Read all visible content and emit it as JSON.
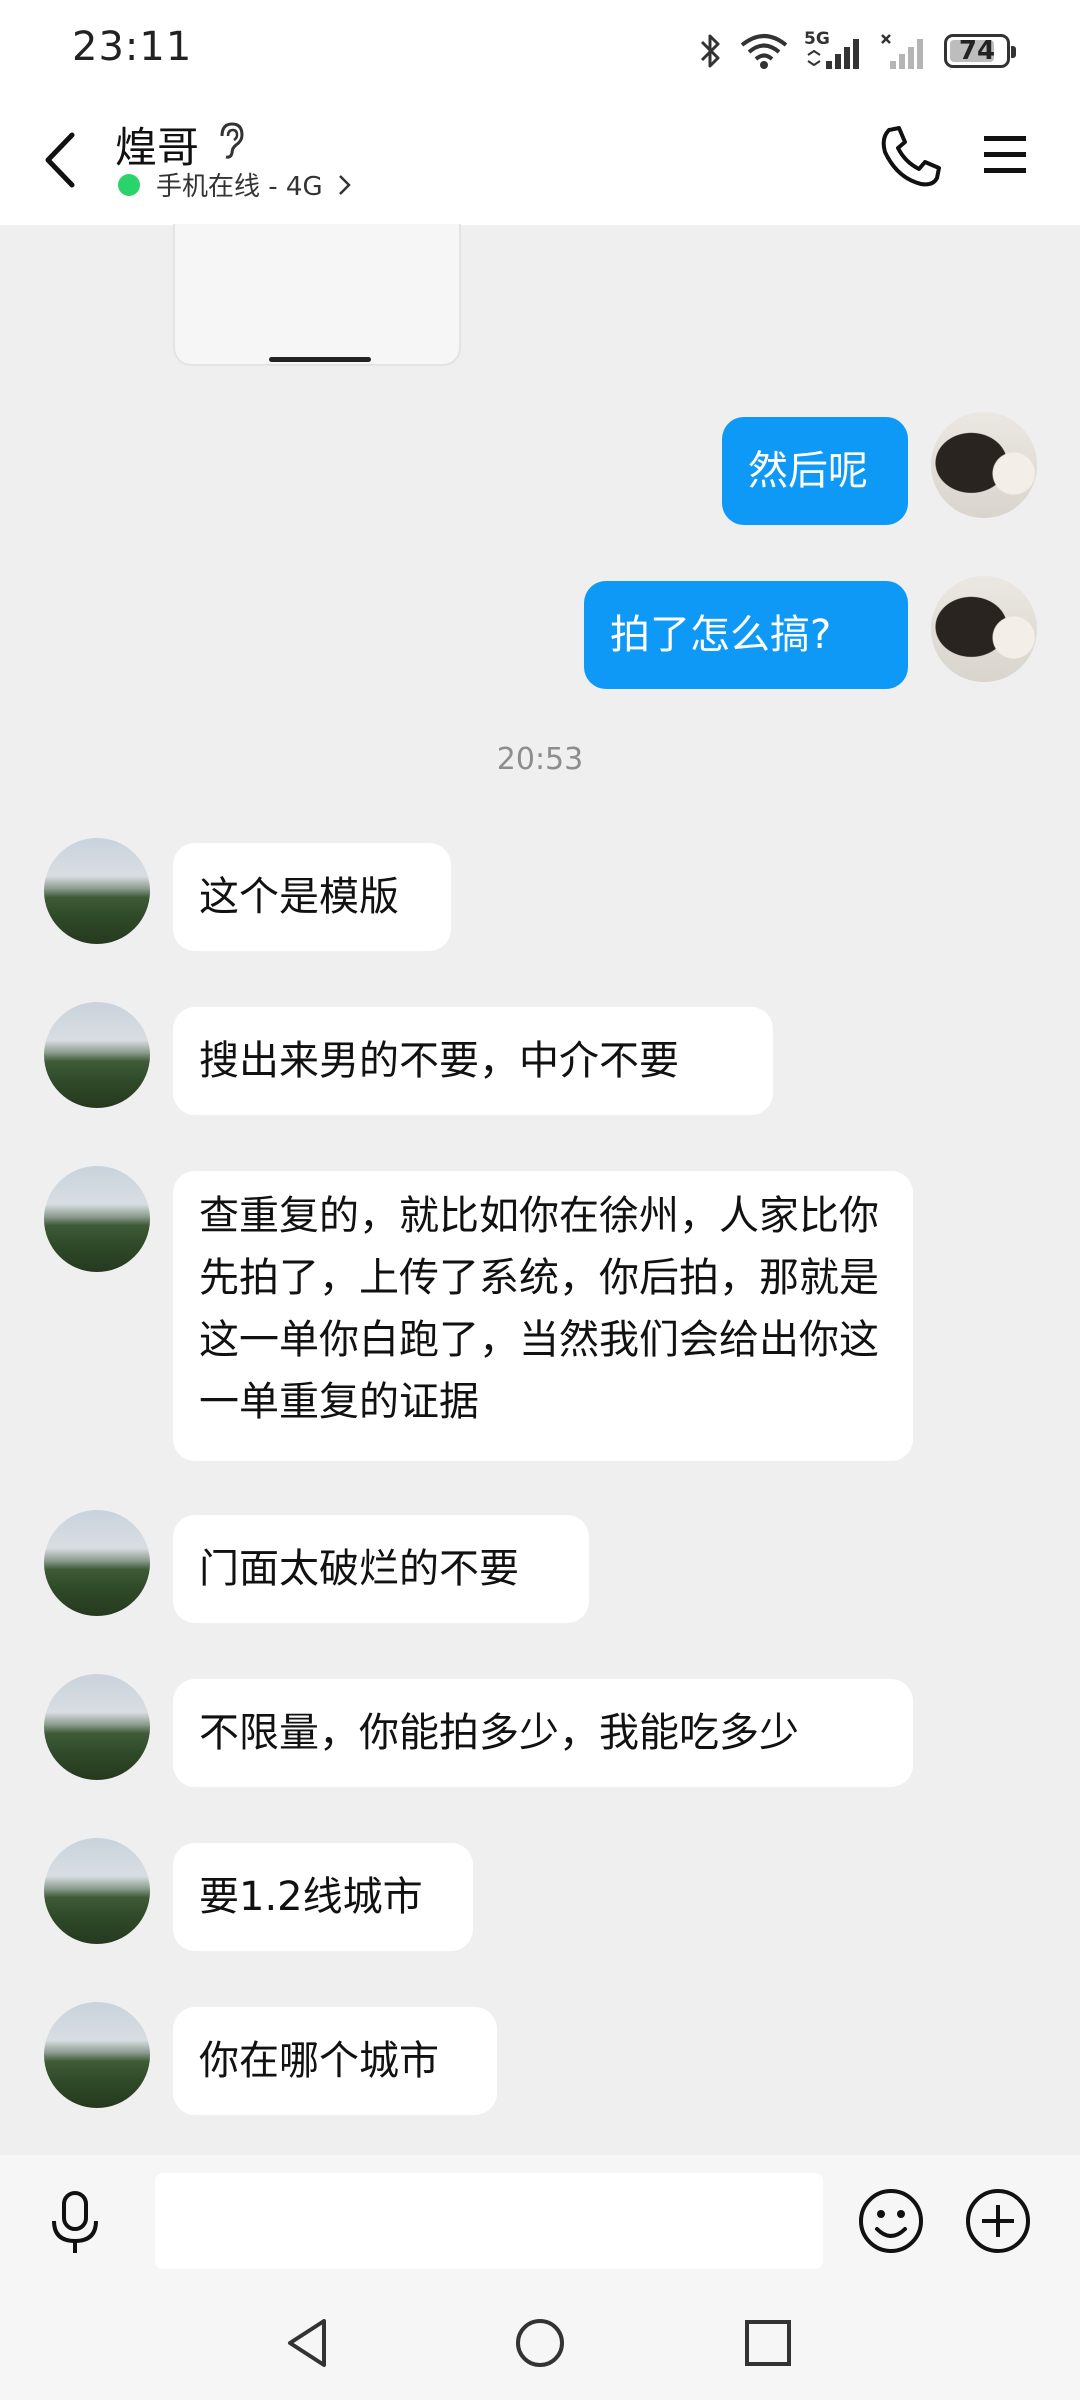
{
  "status_bar": {
    "time": "23:11",
    "battery_level": "74",
    "battery_fraction": 0.74,
    "icons": [
      "bluetooth-icon",
      "wifi-icon",
      "signal-5g-icon",
      "signal-no-sim-icon",
      "battery-icon"
    ],
    "network_label": "5G"
  },
  "header": {
    "contact_name": "煌哥",
    "online_status": "手机在线 - 4G",
    "icons": [
      "back-arrow-icon",
      "ear-icon",
      "chevron-right-icon",
      "phone-icon",
      "menu-icon"
    ]
  },
  "conversation": {
    "timestamp": "20:53",
    "sent": [
      "然后呢",
      "拍了怎么搞?"
    ],
    "received": [
      "这个是模版",
      "搜出来男的不要，中介不要",
      "查重复的，就比如你在徐州，人家比你先拍了，上传了系统，你后拍，那就是这一单你白跑了，当然我们会给出你这一单重复的证据",
      "门面太破烂的不要",
      "不限量，你能拍多少，我能吃多少",
      "要1.2线城市",
      "你在哪个城市"
    ]
  },
  "input_bar": {
    "value": "",
    "icons": [
      "microphone-icon",
      "emoji-icon",
      "plus-icon"
    ]
  },
  "nav_bar": {
    "icons": [
      "nav-back-icon",
      "nav-home-icon",
      "nav-recent-apps-icon"
    ]
  },
  "colors": {
    "sent_bubble": "#0f99f7",
    "received_bubble": "#ffffff",
    "chat_background": "#efefef",
    "online_dot": "#2bd36b"
  }
}
